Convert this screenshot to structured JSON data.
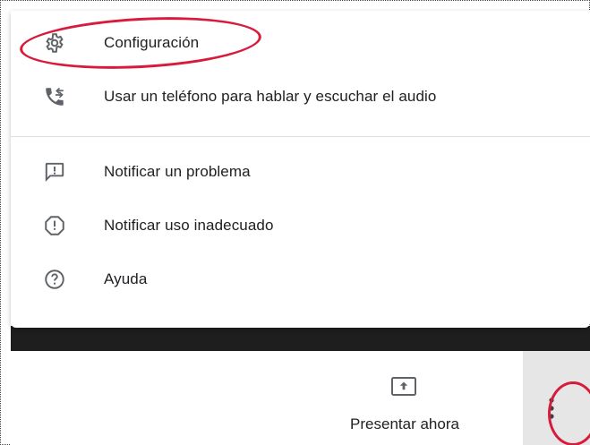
{
  "menu": {
    "items": [
      {
        "label": "Configuración",
        "icon": "gear-icon"
      },
      {
        "label": "Usar un teléfono para hablar y escuchar el audio",
        "icon": "phone-transfer-icon"
      },
      {
        "label": "Notificar un problema",
        "icon": "feedback-icon"
      },
      {
        "label": "Notificar uso inadecuado",
        "icon": "report-icon"
      },
      {
        "label": "Ayuda",
        "icon": "help-icon"
      }
    ]
  },
  "toolbar": {
    "present_label": "Presentar ahora",
    "present_icon": "present-screen-icon",
    "more_icon": "more-vert-icon"
  },
  "colors": {
    "highlight": "#d81b3c",
    "dark_band": "#1e1e1e",
    "more_panel_bg": "#e6e6e6"
  }
}
